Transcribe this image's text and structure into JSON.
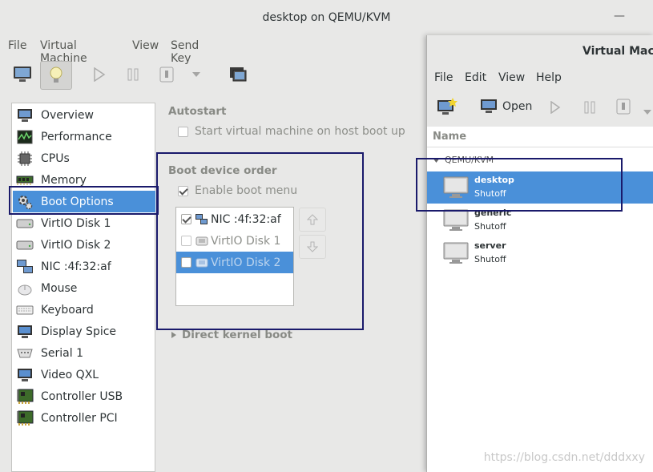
{
  "main_window": {
    "title": "desktop on QEMU/KVM",
    "menu": [
      "File",
      "Virtual Machine",
      "View",
      "Send Key"
    ],
    "toolbar_icons": [
      "monitor-icon",
      "lightbulb-icon",
      "play-icon",
      "pause-icon",
      "power-icon",
      "dropdown-icon",
      "screenshot-icon"
    ]
  },
  "hardware_list": [
    {
      "label": "Overview",
      "icon": "overview-icon"
    },
    {
      "label": "Performance",
      "icon": "performance-icon"
    },
    {
      "label": "CPUs",
      "icon": "cpu-icon"
    },
    {
      "label": "Memory",
      "icon": "memory-icon"
    },
    {
      "label": "Boot Options",
      "icon": "boot-options-icon",
      "selected": true
    },
    {
      "label": "VirtIO Disk 1",
      "icon": "disk-icon"
    },
    {
      "label": "VirtIO Disk 2",
      "icon": "disk-icon"
    },
    {
      "label": "NIC :4f:32:af",
      "icon": "nic-icon"
    },
    {
      "label": "Mouse",
      "icon": "mouse-icon"
    },
    {
      "label": "Keyboard",
      "icon": "keyboard-icon"
    },
    {
      "label": "Display Spice",
      "icon": "display-icon"
    },
    {
      "label": "Serial 1",
      "icon": "serial-icon"
    },
    {
      "label": "Video QXL",
      "icon": "video-icon"
    },
    {
      "label": "Controller USB",
      "icon": "controller-icon"
    },
    {
      "label": "Controller PCI",
      "icon": "controller-icon"
    }
  ],
  "boot_panel": {
    "autostart_heading": "Autostart",
    "autostart_label": "Start virtual machine on host boot up",
    "boot_order_heading": "Boot device order",
    "enable_menu_label": "Enable boot menu",
    "devices": [
      {
        "label": "NIC :4f:32:af",
        "checked": true
      },
      {
        "label": "VirtIO Disk 1",
        "checked": false
      },
      {
        "label": "VirtIO Disk 2",
        "checked": false,
        "selected": true
      }
    ],
    "direct_kernel_label": "Direct kernel boot"
  },
  "vm_manager": {
    "title": "Virtual Machi",
    "menu": [
      "File",
      "Edit",
      "View",
      "Help"
    ],
    "open_label": "Open",
    "column_name": "Name",
    "group": "QEMU/KVM",
    "vms": [
      {
        "name": "desktop",
        "state": "Shutoff",
        "selected": true
      },
      {
        "name": "generic",
        "state": "Shutoff"
      },
      {
        "name": "server",
        "state": "Shutoff"
      }
    ]
  },
  "watermark": "https://blog.csdn.net/dddxxy",
  "colors": {
    "selection": "#4a90d9",
    "annotation": "#1a1a6b"
  }
}
